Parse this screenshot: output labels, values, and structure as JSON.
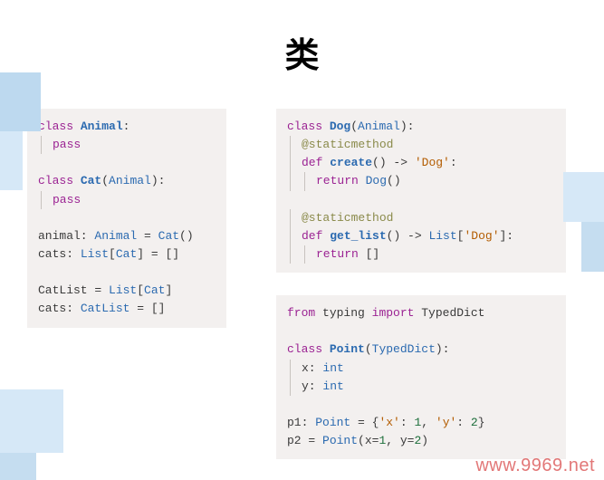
{
  "title": "类",
  "left_block": {
    "l1": {
      "kw": "class",
      "name": "Animal",
      "suffix": ":"
    },
    "l2": {
      "kw": "pass"
    },
    "l3": {
      "kw": "class",
      "name": "Cat",
      "paren_open": "(",
      "base": "Animal",
      "paren_close": "):"
    },
    "l4": {
      "kw": "pass"
    },
    "l5": {
      "t1": "animal: ",
      "typ": "Animal",
      "t2": " = ",
      "call": "Cat",
      "t3": "()"
    },
    "l6": {
      "t1": "cats: ",
      "typ1": "List",
      "t2": "[",
      "typ2": "Cat",
      "t3": "] = []"
    },
    "l7": {
      "t1": "CatList = ",
      "typ1": "List",
      "t2": "[",
      "typ2": "Cat",
      "t3": "]"
    },
    "l8": {
      "t1": "cats: ",
      "typ": "CatList",
      "t2": " = []"
    }
  },
  "right_block1": {
    "l1": {
      "kw": "class",
      "name": "Dog",
      "paren_open": "(",
      "base": "Animal",
      "paren_close": "):"
    },
    "l2": {
      "deco": "@staticmethod"
    },
    "l3": {
      "kw": "def",
      "name": "create",
      "sig1": "() -> ",
      "str": "'Dog'",
      "sig2": ":"
    },
    "l4": {
      "kw": "return",
      "t1": " ",
      "call": "Dog",
      "t2": "()"
    },
    "l5": {
      "deco": "@staticmethod"
    },
    "l6": {
      "kw": "def",
      "name": "get_list",
      "sig1": "() -> ",
      "typ": "List",
      "sig2": "[",
      "str": "'Dog'",
      "sig3": "]:"
    },
    "l7": {
      "kw": "return",
      "t1": " []"
    }
  },
  "right_block2": {
    "l1": {
      "kw1": "from",
      "t1": " typing ",
      "kw2": "import",
      "t2": " TypedDict"
    },
    "l2": {
      "kw": "class",
      "name": "Point",
      "paren_open": "(",
      "base": "TypedDict",
      "paren_close": "):"
    },
    "l3": {
      "t1": "x: ",
      "typ": "int"
    },
    "l4": {
      "t1": "y: ",
      "typ": "int"
    },
    "l5": {
      "t1": "p1: ",
      "typ": "Point",
      "t2": " = {",
      "s1": "'x'",
      "t3": ": ",
      "n1": "1",
      "t4": ", ",
      "s2": "'y'",
      "t5": ": ",
      "n2": "2",
      "t6": "}"
    },
    "l6": {
      "t1": "p2 = ",
      "call": "Point",
      "t2": "(x=",
      "n1": "1",
      "t3": ", y=",
      "n2": "2",
      "t4": ")"
    }
  },
  "watermark": "www.9969.net"
}
